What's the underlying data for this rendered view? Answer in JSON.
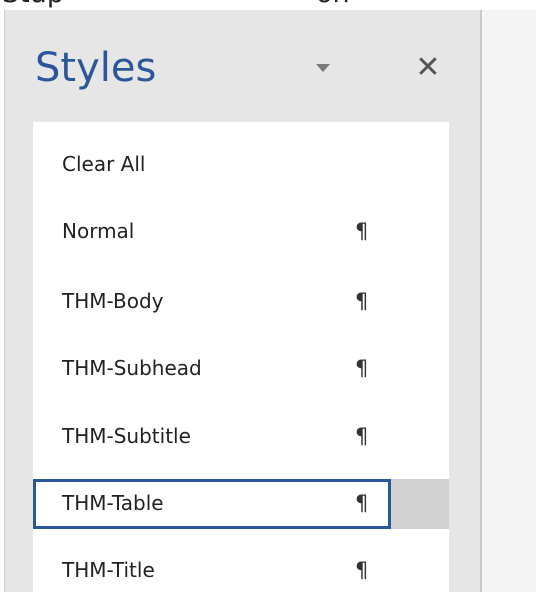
{
  "top_clip": {
    "left_text": "Stup",
    "right_text": "on"
  },
  "pane": {
    "title": "Styles",
    "menu_icon": "caret-down-icon",
    "close_glyph": "✕",
    "close_icon": "close-icon"
  },
  "styles": {
    "paragraph_mark": "¶",
    "items": [
      {
        "label": "Clear All",
        "has_mark": false,
        "selected": false
      },
      {
        "label": "Normal",
        "has_mark": true,
        "selected": false
      },
      {
        "label": "THM-Body",
        "has_mark": true,
        "selected": false
      },
      {
        "label": "THM-Subhead",
        "has_mark": true,
        "selected": false
      },
      {
        "label": "THM-Subtitle",
        "has_mark": true,
        "selected": false
      },
      {
        "label": "THM-Table",
        "has_mark": true,
        "selected": true
      },
      {
        "label": "THM-Title",
        "has_mark": true,
        "selected": false
      }
    ]
  },
  "colors": {
    "accent": "#2b579a",
    "pane_bg": "#e6e6e6",
    "list_bg": "#ffffff",
    "hover_bg": "#d3d3d3"
  }
}
